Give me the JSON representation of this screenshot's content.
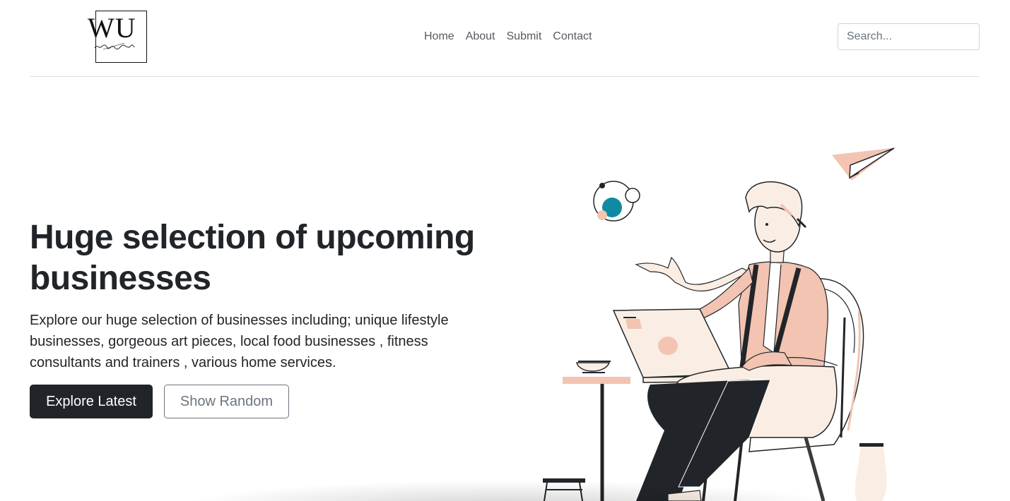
{
  "header": {
    "logo_text": "WU",
    "logo_script": "woork up",
    "nav": [
      "Home",
      "About",
      "Submit",
      "Contact"
    ],
    "search_placeholder": "Search..."
  },
  "hero": {
    "title": "Huge selection of upcoming businesses",
    "description": "Explore our huge selection of businesses including; unique lifestyle businesses, gorgeous art pieces, local food businesses , fitness consultants and trainers , various home services.",
    "primary_button": "Explore Latest",
    "secondary_button": "Show Random"
  },
  "colors": {
    "dark": "#212529",
    "peach": "#f2c4b1",
    "cream": "#faeee4",
    "teal": "#0e8ba3"
  },
  "icons": [
    "logo",
    "hero-illustration"
  ]
}
